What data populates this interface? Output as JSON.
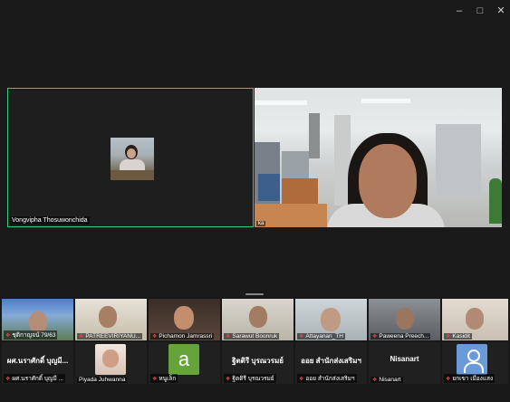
{
  "window": {
    "minimize_icon": "minimize-icon",
    "maximize_icon": "maximize-icon",
    "close_icon": "close-icon"
  },
  "main": {
    "active_name": "Vongvipha Thosuwonchida",
    "speaker_label": "ka"
  },
  "gallery": {
    "row1": [
      {
        "label": "ชุติกาญจน์ 79/63"
      },
      {
        "label": "PATREEVIRIYANU..."
      },
      {
        "label": "Pichamon Jamrassri"
      },
      {
        "label": "Sarawut Boonruk"
      },
      {
        "label": "Attayanan_TH"
      },
      {
        "label": "Paweena Preech..."
      },
      {
        "label": "Kasidit"
      }
    ],
    "row2": [
      {
        "name": "ผศ.นราศักดิ์ บุญมี...",
        "label": "ผศ.นราศักดิ์ บุญมี ..."
      },
      {
        "name": "",
        "label": "Piyada Juhwanna"
      },
      {
        "name": "",
        "label": "หนูเล็ก",
        "avatar_letter": "a"
      },
      {
        "name": "ฐิตติรี บุรณวรมย์",
        "label": "ฐิตติรี บุรณวรมย์"
      },
      {
        "name": "ออย สำนักส่งเสริมฯ",
        "label": "ออย สำนักส่งเสริมฯ"
      },
      {
        "name": "Nisanart",
        "label": "Nisanart"
      },
      {
        "name": "",
        "label": "ยกเขา เมืองแสง"
      }
    ]
  }
}
